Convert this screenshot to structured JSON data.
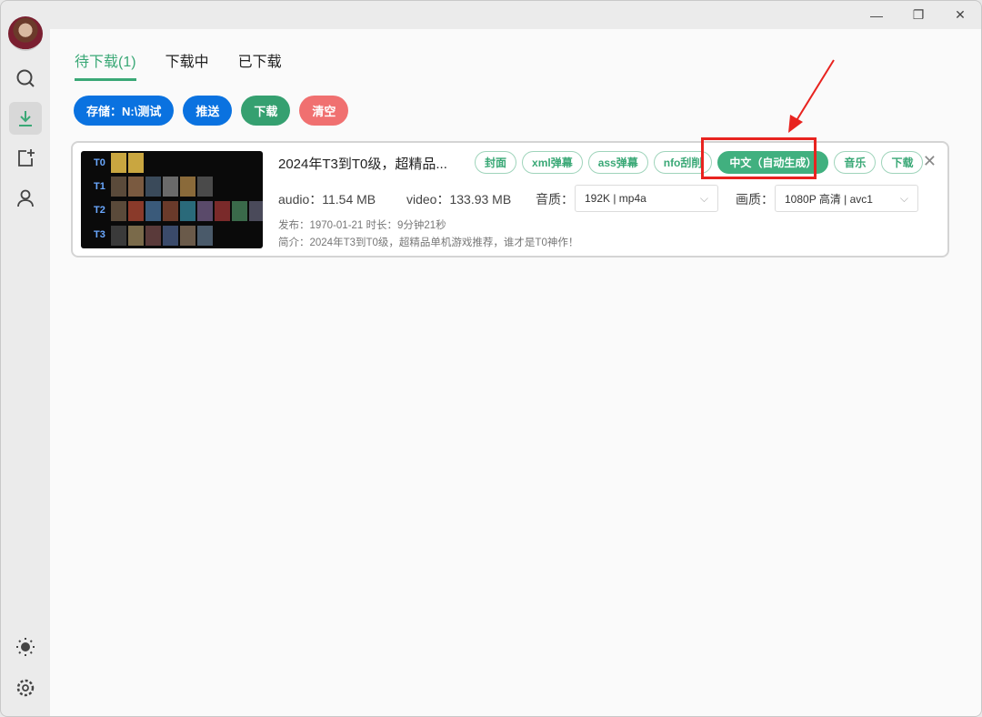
{
  "window": {
    "minimize_icon": "minimize-icon",
    "restore_icon": "restore-icon",
    "close_icon": "close-icon"
  },
  "sidebar": {
    "items": [
      {
        "icon": "search-icon"
      },
      {
        "icon": "download-icon",
        "active": true
      },
      {
        "icon": "add-task-icon"
      },
      {
        "icon": "user-icon"
      }
    ],
    "bottom": [
      {
        "icon": "theme-sun-icon"
      },
      {
        "icon": "gear-icon"
      }
    ]
  },
  "tabs": [
    {
      "label": "待下载(1)",
      "active": true
    },
    {
      "label": "下载中"
    },
    {
      "label": "已下载"
    }
  ],
  "actions": {
    "storage": "存储：N:\\测试",
    "push": "推送",
    "download": "下载",
    "clear": "清空"
  },
  "colors": {
    "accent": "#3aa876",
    "blue": "#0a72e0",
    "red": "#f07070",
    "highlight": "#e8231f"
  },
  "item": {
    "thumbnail_labels": [
      "T0",
      "T1",
      "T2",
      "T3"
    ],
    "title": "2024年T3到T0级，超精品...",
    "tags": [
      "封面",
      "xml弹幕",
      "ass弹幕",
      "nfo刮削",
      "中文（自动生成）",
      "音乐",
      "下载"
    ],
    "audio": "audio：11.54 MB",
    "video": "video：133.93 MB",
    "audio_quality_label": "音质：",
    "audio_quality_value": "192K | mp4a",
    "video_quality_label": "画质：",
    "video_quality_value": "1080P 高清 | avc1",
    "publish": "发布：1970-01-21 时长：9分钟21秒",
    "intro": "简介：2024年T3到T0级，超精品单机游戏推荐，谁才是T0神作！"
  }
}
